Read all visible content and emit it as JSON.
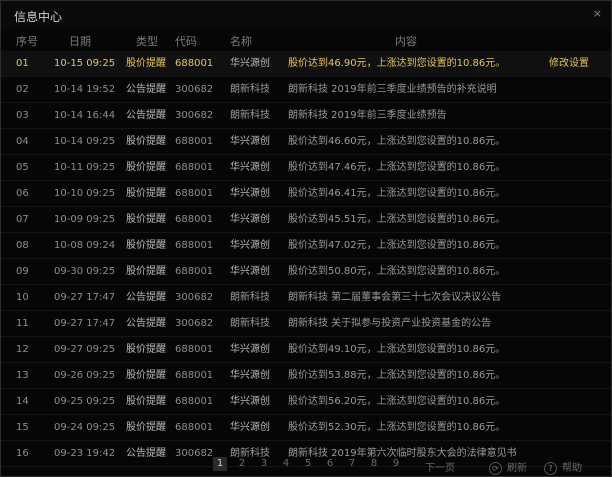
{
  "window": {
    "title": "信息中心",
    "close_glyph": "×"
  },
  "columns": {
    "seq": "序号",
    "date": "日期",
    "type": "类型",
    "code": "代码",
    "name": "名称",
    "content": "内容"
  },
  "rows": [
    {
      "seq": "01",
      "date": "10-15 09:25",
      "type": "股价提醒",
      "code": "688001",
      "name": "华兴源创",
      "content": "股价达到46.90元，上涨达到您设置的10.86元。",
      "action": "修改设置",
      "selected": true
    },
    {
      "seq": "02",
      "date": "10-14 19:52",
      "type": "公告提醒",
      "code": "300682",
      "name": "朗新科技",
      "content": "朗新科技 2019年前三季度业绩预告的补充说明",
      "action": ""
    },
    {
      "seq": "03",
      "date": "10-14 16:44",
      "type": "公告提醒",
      "code": "300682",
      "name": "朗新科技",
      "content": "朗新科技 2019年前三季度业绩预告",
      "action": ""
    },
    {
      "seq": "04",
      "date": "10-14 09:25",
      "type": "股价提醒",
      "code": "688001",
      "name": "华兴源创",
      "content": "股价达到46.60元，上涨达到您设置的10.86元。",
      "action": ""
    },
    {
      "seq": "05",
      "date": "10-11 09:25",
      "type": "股价提醒",
      "code": "688001",
      "name": "华兴源创",
      "content": "股价达到47.46元，上涨达到您设置的10.86元。",
      "action": ""
    },
    {
      "seq": "06",
      "date": "10-10 09:25",
      "type": "股价提醒",
      "code": "688001",
      "name": "华兴源创",
      "content": "股价达到46.41元，上涨达到您设置的10.86元。",
      "action": ""
    },
    {
      "seq": "07",
      "date": "10-09 09:25",
      "type": "股价提醒",
      "code": "688001",
      "name": "华兴源创",
      "content": "股价达到45.51元，上涨达到您设置的10.86元。",
      "action": ""
    },
    {
      "seq": "08",
      "date": "10-08 09:24",
      "type": "股价提醒",
      "code": "688001",
      "name": "华兴源创",
      "content": "股价达到47.02元，上涨达到您设置的10.86元。",
      "action": ""
    },
    {
      "seq": "09",
      "date": "09-30 09:25",
      "type": "股价提醒",
      "code": "688001",
      "name": "华兴源创",
      "content": "股价达到50.80元，上涨达到您设置的10.86元。",
      "action": ""
    },
    {
      "seq": "10",
      "date": "09-27 17:47",
      "type": "公告提醒",
      "code": "300682",
      "name": "朗新科技",
      "content": "朗新科技 第二届董事会第三十七次会议决议公告",
      "action": ""
    },
    {
      "seq": "11",
      "date": "09-27 17:47",
      "type": "公告提醒",
      "code": "300682",
      "name": "朗新科技",
      "content": "朗新科技 关于拟参与投资产业投资基金的公告",
      "action": ""
    },
    {
      "seq": "12",
      "date": "09-27 09:25",
      "type": "股价提醒",
      "code": "688001",
      "name": "华兴源创",
      "content": "股价达到49.10元，上涨达到您设置的10.86元。",
      "action": ""
    },
    {
      "seq": "13",
      "date": "09-26 09:25",
      "type": "股价提醒",
      "code": "688001",
      "name": "华兴源创",
      "content": "股价达到53.88元，上涨达到您设置的10.86元。",
      "action": ""
    },
    {
      "seq": "14",
      "date": "09-25 09:25",
      "type": "股价提醒",
      "code": "688001",
      "name": "华兴源创",
      "content": "股价达到56.20元，上涨达到您设置的10.86元。",
      "action": ""
    },
    {
      "seq": "15",
      "date": "09-24 09:25",
      "type": "股价提醒",
      "code": "688001",
      "name": "华兴源创",
      "content": "股价达到52.30元，上涨达到您设置的10.86元。",
      "action": ""
    },
    {
      "seq": "16",
      "date": "09-23 19:42",
      "type": "公告提醒",
      "code": "300682",
      "name": "朗新科技",
      "content": "朗新科技 2019年第六次临时股东大会的法律意见书",
      "action": ""
    }
  ],
  "pagination": {
    "pages": [
      "1",
      "2",
      "3",
      "4",
      "5",
      "6",
      "7",
      "8",
      "9"
    ],
    "current": "1",
    "next_label": "下一页",
    "refresh_label": "刷新",
    "help_label": "帮助"
  },
  "colors": {
    "highlight": "#e6c65a",
    "background": "#060606"
  }
}
